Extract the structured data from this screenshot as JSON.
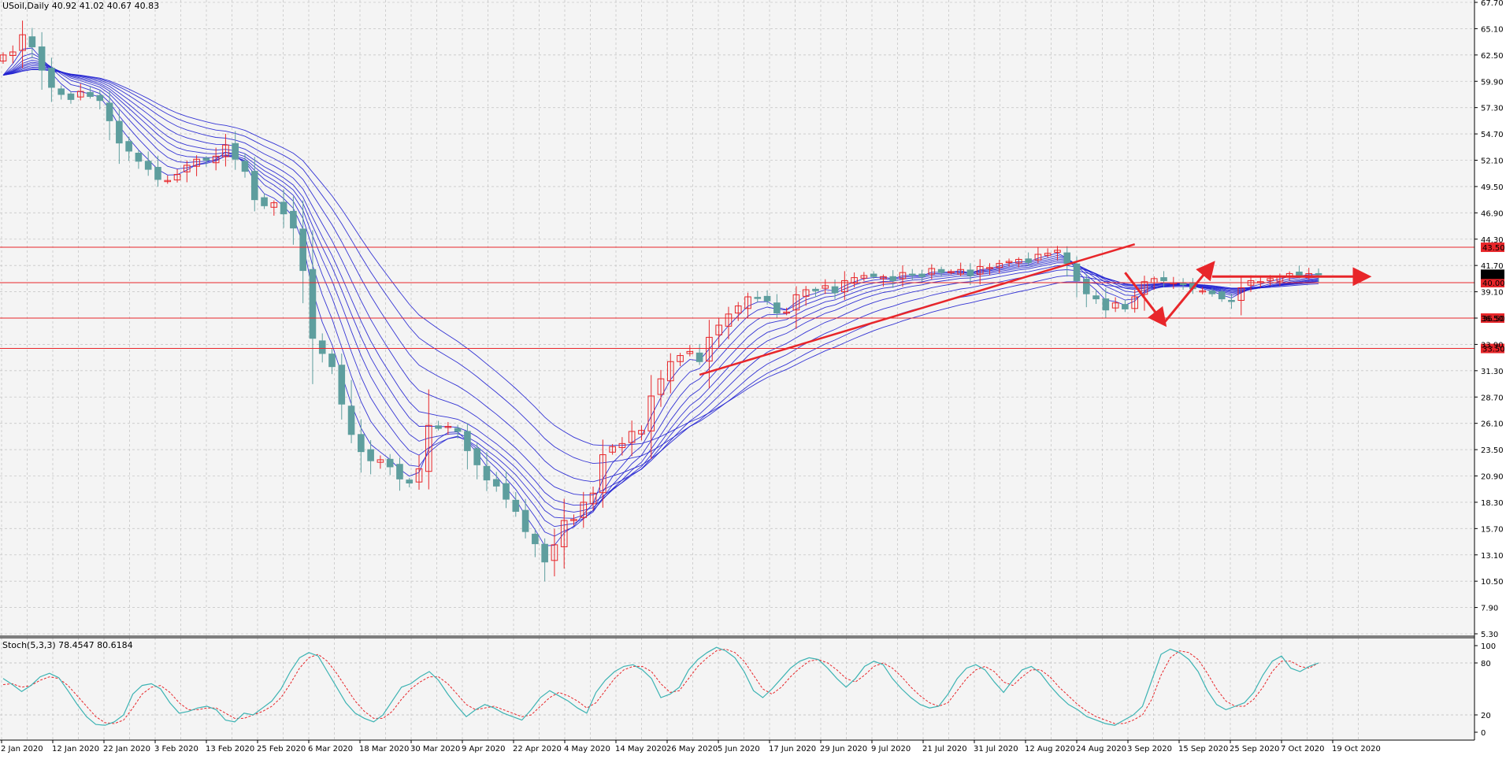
{
  "colors": {
    "background": "#f4f4f4",
    "grid": "#c8c8c8",
    "bull_candle": "#e8262a",
    "bear_candle": "#5e9e9e",
    "ribbon": "#1f1fd0",
    "level_line": "#e8262a",
    "trendline": "#e8262a",
    "stoch_main": "#3cb3b3",
    "stoch_signal": "#e8262a"
  },
  "main_header": {
    "symbol": "USoil,Daily",
    "ohlc": "40.92 41.02 40.67 40.83"
  },
  "stoch_header": {
    "label": "Stoch(5,3,3) 78.4547 80.6184"
  },
  "chart_data": [
    {
      "type": "candlestick",
      "ylim": [
        5.3,
        67.7
      ],
      "y_ticks": [
        "67.70",
        "65.10",
        "62.50",
        "59.90",
        "57.30",
        "54.70",
        "52.10",
        "49.50",
        "46.90",
        "44.30",
        "41.70",
        "39.10",
        "36.50",
        "33.90",
        "31.30",
        "28.70",
        "26.10",
        "23.50",
        "20.90",
        "18.30",
        "15.70",
        "13.10",
        "10.50",
        "7.90",
        "5.30"
      ],
      "x_labels": [
        "2 Jan 2020",
        "12 Jan 2020",
        "22 Jan 2020",
        "3 Feb 2020",
        "13 Feb 2020",
        "25 Feb 2020",
        "6 Mar 2020",
        "18 Mar 2020",
        "30 Mar 2020",
        "9 Apr 2020",
        "22 Apr 2020",
        "4 May 2020",
        "14 May 2020",
        "26 May 2020",
        "5 Jun 2020",
        "17 Jun 2020",
        "29 Jun 2020",
        "9 Jul 2020",
        "21 Jul 2020",
        "31 Jul 2020",
        "12 Aug 2020",
        "24 Aug 2020",
        "3 Sep 2020",
        "15 Sep 2020",
        "25 Sep 2020",
        "7 Oct 2020",
        "19 Oct 2020"
      ],
      "close_trend": [
        62.5,
        62.8,
        64.5,
        63.3,
        61.0,
        59.3,
        58.6,
        58.1,
        58.9,
        58.4,
        58.0,
        56.0,
        53.8,
        53.0,
        52.0,
        51.2,
        50.2,
        50.1,
        50.7,
        51.6,
        52.2,
        52.1,
        52.5,
        53.6,
        52.2,
        51.0,
        48.2,
        47.6,
        47.9,
        46.8,
        45.4,
        41.2,
        34.5,
        33.0,
        31.7,
        28.0,
        25.0,
        23.3,
        22.4,
        22.5,
        21.8,
        20.6,
        20.2,
        21.6,
        25.9,
        25.6,
        25.8,
        25.3,
        23.4,
        22.0,
        20.5,
        19.9,
        18.6,
        17.4,
        15.4,
        14.2,
        12.4,
        14.1,
        16.5,
        16.6,
        18.3,
        19.2,
        23.0,
        23.8,
        24.1,
        25.3,
        25.4,
        28.8,
        30.5,
        32.2,
        32.8,
        33.2,
        32.2,
        34.6,
        35.8,
        36.9,
        37.7,
        38.6,
        38.5,
        38.2,
        37.0,
        37.1,
        38.8,
        39.3,
        39.2,
        39.7,
        39.0,
        40.2,
        40.5,
        40.7,
        40.6,
        40.6,
        40.2,
        41.0,
        40.8,
        40.6,
        41.4,
        41.0,
        41.1,
        41.3,
        40.7,
        41.6,
        41.5,
        41.9,
        42.1,
        42.3,
        42.0,
        42.8,
        42.9,
        43.2,
        41.9,
        40.2,
        38.9,
        38.4,
        37.3,
        38.0,
        37.4,
        38.6,
        40.1,
        40.4,
        40.2,
        40.0,
        39.8,
        39.4,
        39.2,
        38.9,
        38.4,
        38.2,
        39.5,
        40.2,
        40.1,
        40.4,
        40.6,
        40.9,
        40.7,
        40.9,
        40.83
      ],
      "levels": [
        {
          "value": 43.5,
          "label": "43.50"
        },
        {
          "value": 40.0,
          "label": "40.00"
        },
        {
          "value": 36.5,
          "label": "36.50"
        },
        {
          "value": 33.5,
          "label": "33.50"
        }
      ],
      "current_price": {
        "value": 40.83,
        "label": "40.83"
      },
      "trendlines": [
        {
          "from": {
            "bar": 72,
            "price": 30.9
          },
          "to": {
            "bar": 117,
            "price": 43.8
          }
        }
      ],
      "arrows": [
        {
          "from": {
            "bar": 116,
            "price": 41.0
          },
          "to": {
            "bar": 120,
            "price": 36.0
          }
        },
        {
          "from": {
            "bar": 120,
            "price": 36.0
          },
          "to": {
            "bar": 125,
            "price": 41.8
          }
        },
        {
          "from": {
            "bar": 125,
            "price": 40.6
          },
          "to": {
            "bar": 141,
            "price": 40.6
          }
        }
      ]
    },
    {
      "type": "line",
      "ylim": [
        0,
        100
      ],
      "y_ticks": [
        "100",
        "80",
        "20",
        "0"
      ],
      "series_main": [
        62,
        55,
        47,
        54,
        64,
        68,
        63,
        48,
        32,
        18,
        9,
        8,
        12,
        20,
        44,
        54,
        56,
        50,
        34,
        22,
        24,
        28,
        30,
        26,
        14,
        12,
        22,
        20,
        28,
        36,
        50,
        70,
        86,
        92,
        88,
        70,
        52,
        34,
        22,
        16,
        12,
        20,
        36,
        52,
        56,
        64,
        70,
        60,
        44,
        30,
        18,
        26,
        32,
        28,
        22,
        18,
        14,
        26,
        40,
        48,
        42,
        36,
        28,
        22,
        46,
        60,
        70,
        76,
        78,
        72,
        62,
        40,
        44,
        52,
        72,
        84,
        92,
        98,
        94,
        86,
        70,
        48,
        40,
        50,
        62,
        74,
        82,
        86,
        84,
        74,
        62,
        52,
        62,
        76,
        82,
        78,
        62,
        50,
        40,
        32,
        28,
        30,
        44,
        62,
        74,
        78,
        72,
        58,
        46,
        60,
        72,
        76,
        68,
        54,
        42,
        32,
        26,
        18,
        14,
        10,
        8,
        14,
        20,
        30,
        60,
        90,
        96,
        92,
        84,
        70,
        48,
        32,
        26,
        30,
        34,
        46,
        66,
        82,
        88,
        74,
        70,
        76,
        80
      ],
      "series_signal": [
        55,
        56,
        52,
        54,
        60,
        64,
        62,
        54,
        42,
        30,
        18,
        11,
        10,
        14,
        28,
        44,
        52,
        54,
        46,
        34,
        26,
        26,
        28,
        28,
        22,
        16,
        16,
        20,
        24,
        30,
        40,
        56,
        74,
        86,
        90,
        82,
        68,
        52,
        36,
        24,
        16,
        16,
        24,
        38,
        50,
        58,
        64,
        64,
        56,
        44,
        32,
        26,
        28,
        30,
        26,
        22,
        18,
        20,
        30,
        40,
        46,
        42,
        36,
        28,
        34,
        48,
        62,
        72,
        76,
        76,
        70,
        56,
        46,
        48,
        62,
        76,
        86,
        94,
        96,
        92,
        82,
        66,
        50,
        44,
        52,
        64,
        74,
        82,
        84,
        80,
        72,
        62,
        58,
        66,
        76,
        80,
        74,
        64,
        52,
        42,
        34,
        30,
        34,
        48,
        62,
        72,
        76,
        70,
        58,
        54,
        64,
        72,
        72,
        64,
        52,
        42,
        32,
        24,
        18,
        14,
        10,
        10,
        14,
        20,
        38,
        66,
        86,
        94,
        92,
        84,
        68,
        50,
        36,
        30,
        30,
        38,
        52,
        70,
        82,
        82,
        76,
        74,
        80
      ]
    }
  ]
}
